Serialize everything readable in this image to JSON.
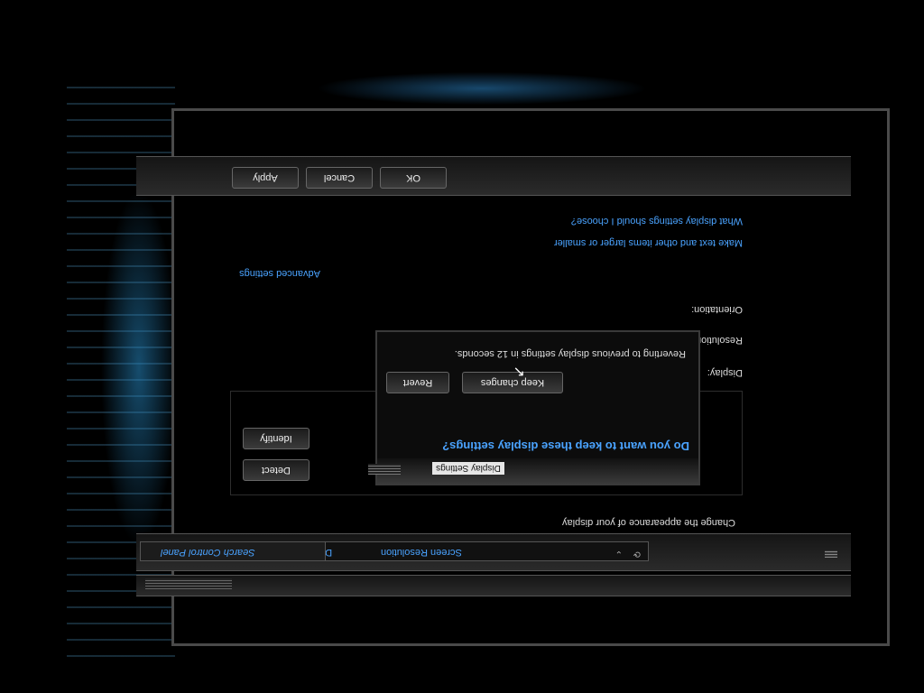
{
  "window": {
    "title": "Display Settings",
    "address": {
      "crumbs": [
        "Display",
        "Screen Resolution"
      ],
      "search_placeholder": "Search Control Panel"
    },
    "heading": "Change the appearance of your display",
    "buttons": {
      "detect": "Detect",
      "identify": "Identify",
      "ok": "OK",
      "cancel": "Cancel",
      "apply": "Apply"
    },
    "labels": {
      "display": "Display:",
      "resolution": "Resolution:",
      "orientation": "Orientation:"
    },
    "links": {
      "advanced": "Advanced settings",
      "text_size": "Make text and other items larger or smaller",
      "help": "What display settings should I choose?"
    }
  },
  "dialog": {
    "title": "Display Settings",
    "question": "Do you want to keep these display settings?",
    "keep_label": "Keep changes",
    "revert_label": "Revert",
    "countdown": "Reverting to previous display settings in 12 seconds."
  },
  "icons": [
    "display-settings-icon",
    "back-icon",
    "refresh-icon",
    "chevron-down-icon",
    "cursor-icon"
  ],
  "colors": {
    "accent": "#4aa3ff",
    "background": "#000000"
  }
}
